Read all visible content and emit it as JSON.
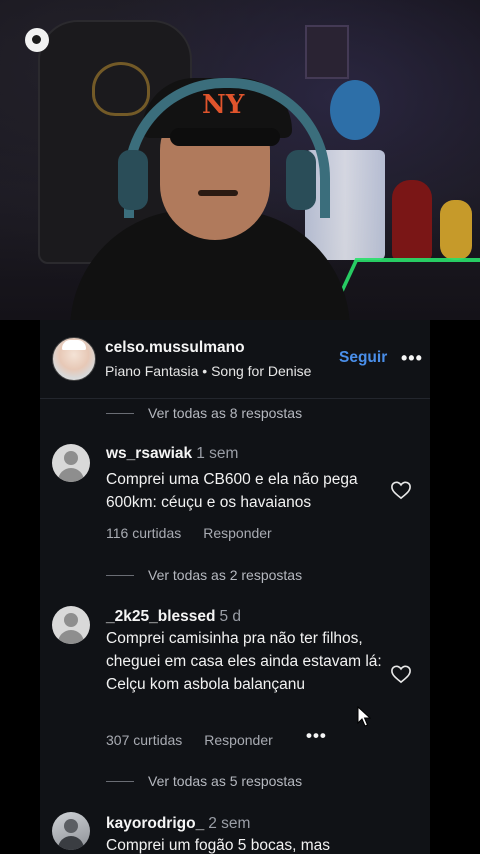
{
  "post": {
    "username": "celso.mussulmano",
    "subtitle": "Piano Fantasia • Song for Denise",
    "follow_label": "Seguir",
    "more_label": "•••"
  },
  "threads": [
    {
      "view_replies_label": "Ver todas as 8 respostas"
    }
  ],
  "comments": [
    {
      "username": "ws_rsawiak",
      "time": "1 sem",
      "text": "Comprei uma CB600 e ela não pega 600km: céuçu e os havaianos",
      "likes_label": "116 curtidas",
      "reply_label": "Responder",
      "view_replies_label": "Ver todas as 2 respostas"
    },
    {
      "username": "_2k25_blessed",
      "time": "5 d",
      "text": "Comprei camisinha pra não ter filhos, cheguei em casa eles ainda estavam lá: Celçu kom asbola balançanu",
      "likes_label": "307 curtidas",
      "reply_label": "Responder",
      "more_label": "•••",
      "view_replies_label": "Ver todas as 5 respostas"
    },
    {
      "username": "kayorodrigo_",
      "time": "2 sem",
      "text": "Comprei um fogão 5 bocas, mas"
    }
  ],
  "icons": {
    "heart": "heart-outline-icon",
    "record": "record-icon",
    "cursor": "mouse-pointer-icon"
  },
  "colors": {
    "accent": "#4a8fea",
    "panel_bg": "#101216"
  }
}
